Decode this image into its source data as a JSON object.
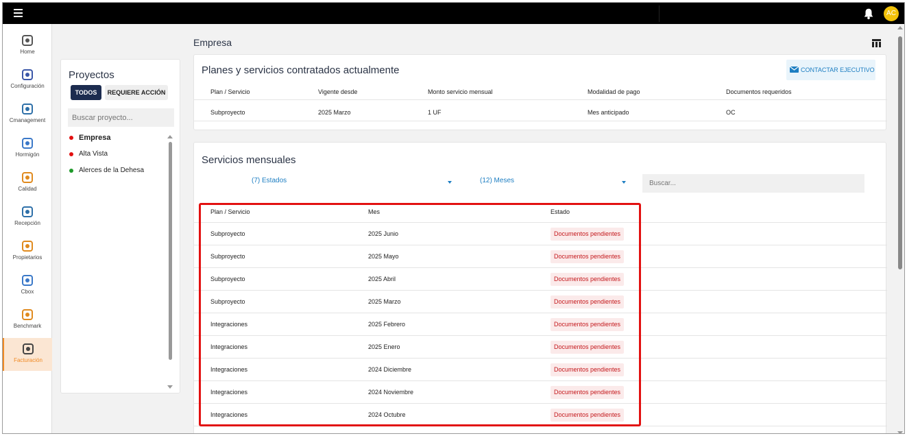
{
  "topbar": {
    "avatar_initials": "AC",
    "accent_color": "#f2c20a"
  },
  "nav": [
    {
      "label": "Home",
      "icon": "home-icon"
    },
    {
      "label": "Configuración",
      "icon": "gear-icon"
    },
    {
      "label": "Cmanagement",
      "icon": "flag-icon"
    },
    {
      "label": "Hormigón",
      "icon": "wheelbarrow-icon"
    },
    {
      "label": "Calidad",
      "icon": "check-icon"
    },
    {
      "label": "Recepción",
      "icon": "reception-icon"
    },
    {
      "label": "Propietarios",
      "icon": "people-icon"
    },
    {
      "label": "Cbox",
      "icon": "box-icon"
    },
    {
      "label": "Benchmark",
      "icon": "benchmark-icon"
    },
    {
      "label": "Facturación",
      "icon": "invoice-icon",
      "active": true
    }
  ],
  "projects": {
    "title": "Proyectos",
    "tab_all": "TODOS",
    "tab_action": "REQUIERE ACCIÓN",
    "search_placeholder": "Buscar proyecto...",
    "items": [
      {
        "name": "Empresa",
        "color": "#e21010",
        "active": true
      },
      {
        "name": "Alta Vista",
        "color": "#e21010"
      },
      {
        "name": "Alerces de la Dehesa",
        "color": "#1f9a2a"
      }
    ]
  },
  "main": {
    "title": "Empresa",
    "planes": {
      "title": "Planes y servicios contratados actualmente",
      "contact_button": "CONTACTAR EJECUTIVO",
      "headers": [
        "Plan / Servicio",
        "Vigente desde",
        "Monto servicio mensual",
        "Modalidad de pago",
        "Documentos requeridos"
      ],
      "row": [
        "Subproyecto",
        "2025 Marzo",
        "1 UF",
        "Mes anticipado",
        "OC"
      ]
    },
    "servicios": {
      "title": "Servicios mensuales",
      "filter_estados": "(7) Estados",
      "filter_meses": "(12) Meses",
      "search_placeholder": "Buscar...",
      "headers": [
        "Plan / Servicio",
        "Mes",
        "Estado"
      ],
      "rows": [
        [
          "Subproyecto",
          "2025 Junio",
          "Documentos pendientes"
        ],
        [
          "Subproyecto",
          "2025 Mayo",
          "Documentos pendientes"
        ],
        [
          "Subproyecto",
          "2025 Abril",
          "Documentos pendientes"
        ],
        [
          "Subproyecto",
          "2025 Marzo",
          "Documentos pendientes"
        ],
        [
          "Integraciones",
          "2025 Febrero",
          "Documentos pendientes"
        ],
        [
          "Integraciones",
          "2025 Enero",
          "Documentos pendientes"
        ],
        [
          "Integraciones",
          "2024 Diciembre",
          "Documentos pendientes"
        ],
        [
          "Integraciones",
          "2024 Noviembre",
          "Documentos pendientes"
        ],
        [
          "Integraciones",
          "2024 Octubre",
          "Documentos pendientes"
        ]
      ]
    }
  }
}
